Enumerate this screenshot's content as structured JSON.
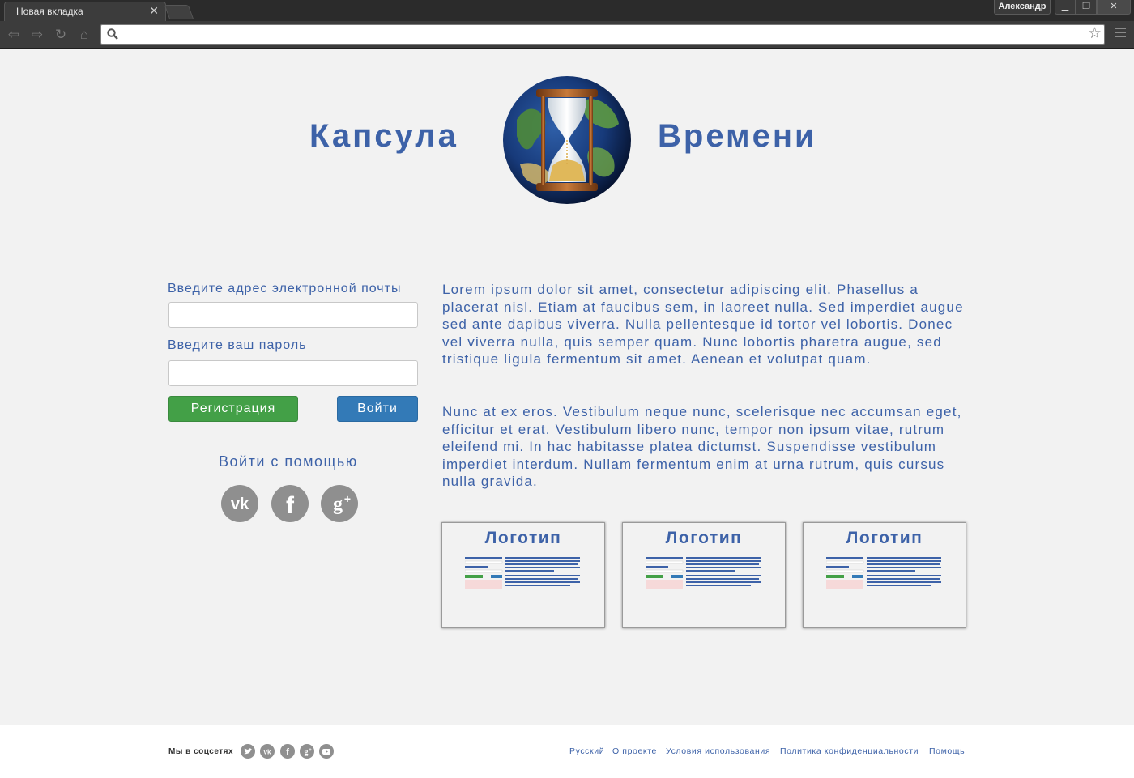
{
  "browser": {
    "tab_title": "Новая вкладка",
    "user_name": "Александр",
    "omnibox_value": ""
  },
  "header": {
    "title_left": "Капсула",
    "title_right": "Времени"
  },
  "login": {
    "email_label": "Введите адрес электронной почты",
    "email_value": "",
    "password_label": "Введите ваш пароль",
    "password_value": "",
    "register_label": "Регистрация",
    "login_label": "Войти",
    "social_title": "Войти с помощью",
    "social": [
      "vk-icon",
      "facebook-icon",
      "google-plus-icon"
    ]
  },
  "content": {
    "paragraph_1": "Lorem ipsum dolor sit amet, consectetur adipiscing elit. Phasellus a placerat nisl. Etiam at faucibus sem, in laoreet nulla. Sed imperdiet augue sed ante dapibus viverra. Nulla pellentesque id tortor vel lobortis. Donec vel viverra nulla, quis semper quam. Nunc lobortis pharetra augue, sed tristique ligula fermentum sit amet. Aenean et volutpat quam.",
    "paragraph_2": "Nunc at ex eros. Vestibulum neque nunc, scelerisque nec accumsan eget, efficitur et erat. Vestibulum libero nunc, tempor non ipsum vitae, rutrum eleifend mi. In hac habitasse platea dictumst. Suspendisse vestibulum imperdiet interdum. Nullam fermentum enim at urna rutrum, quis cursus nulla gravida."
  },
  "cards": [
    {
      "title": "Логотип"
    },
    {
      "title": "Логотип"
    },
    {
      "title": "Логотип"
    }
  ],
  "footer": {
    "social_label": "Мы в соцсетях",
    "social_icons": [
      "twitter-icon",
      "vk-icon",
      "facebook-icon",
      "google-plus-icon",
      "youtube-icon"
    ],
    "links": [
      "Русский",
      "О проекте",
      "Условия использования",
      "Политика конфиденциальности",
      "Помощь"
    ]
  },
  "colors": {
    "brand_blue": "#3d62a8",
    "register_green": "#43a047",
    "login_blue": "#337ab7",
    "icon_gray": "#8f8f8f"
  }
}
